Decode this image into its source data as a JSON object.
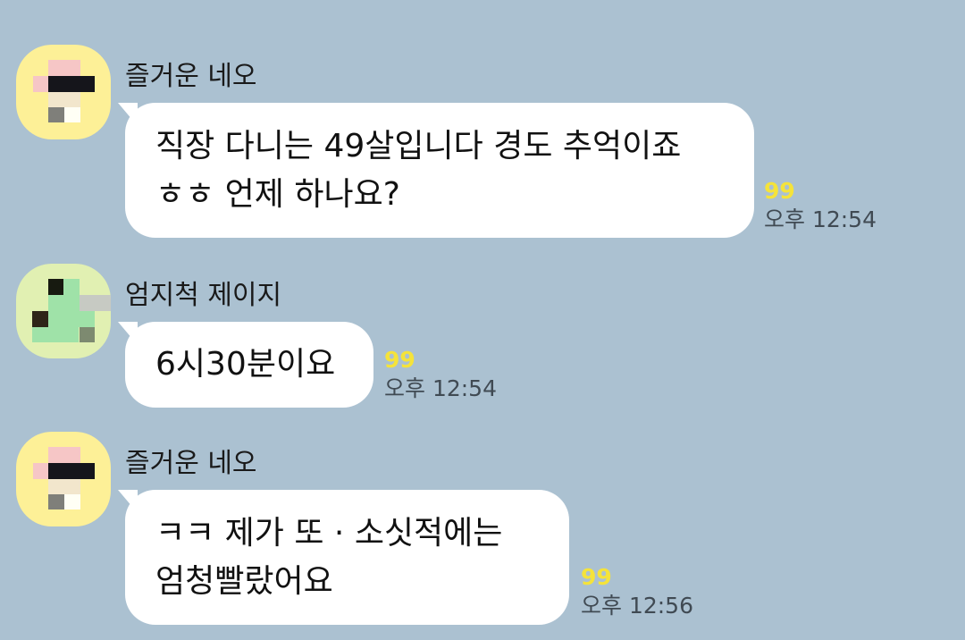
{
  "messages": [
    {
      "sender": "즐거운 네오",
      "avatar": {
        "color": "#fdf097",
        "icon": "pixelated-avatar-yellow"
      },
      "lines": [
        "직장 다니는 49살입니다 경도 추억이죠",
        "ㅎㅎ 언제 하나요?"
      ],
      "unread": "99",
      "time": "오후 12:54"
    },
    {
      "sender": "엄지척 제이지",
      "avatar": {
        "color": "#e1f0b2",
        "icon": "pixelated-avatar-green"
      },
      "lines": [
        "6시30분이요"
      ],
      "unread": "99",
      "time": "오후 12:54"
    },
    {
      "sender": "즐거운 네오",
      "avatar": {
        "color": "#fdf097",
        "icon": "pixelated-avatar-yellow"
      },
      "lines": [
        "ㅋㅋ 제가 또 ·  소싯적에는",
        "엄청빨랐어요"
      ],
      "unread": "99",
      "time": "오후 12:56"
    }
  ],
  "colors": {
    "background": "#abc1d1",
    "bubble": "#ffffff",
    "unread": "#f5e33a",
    "time": "#404a53"
  }
}
